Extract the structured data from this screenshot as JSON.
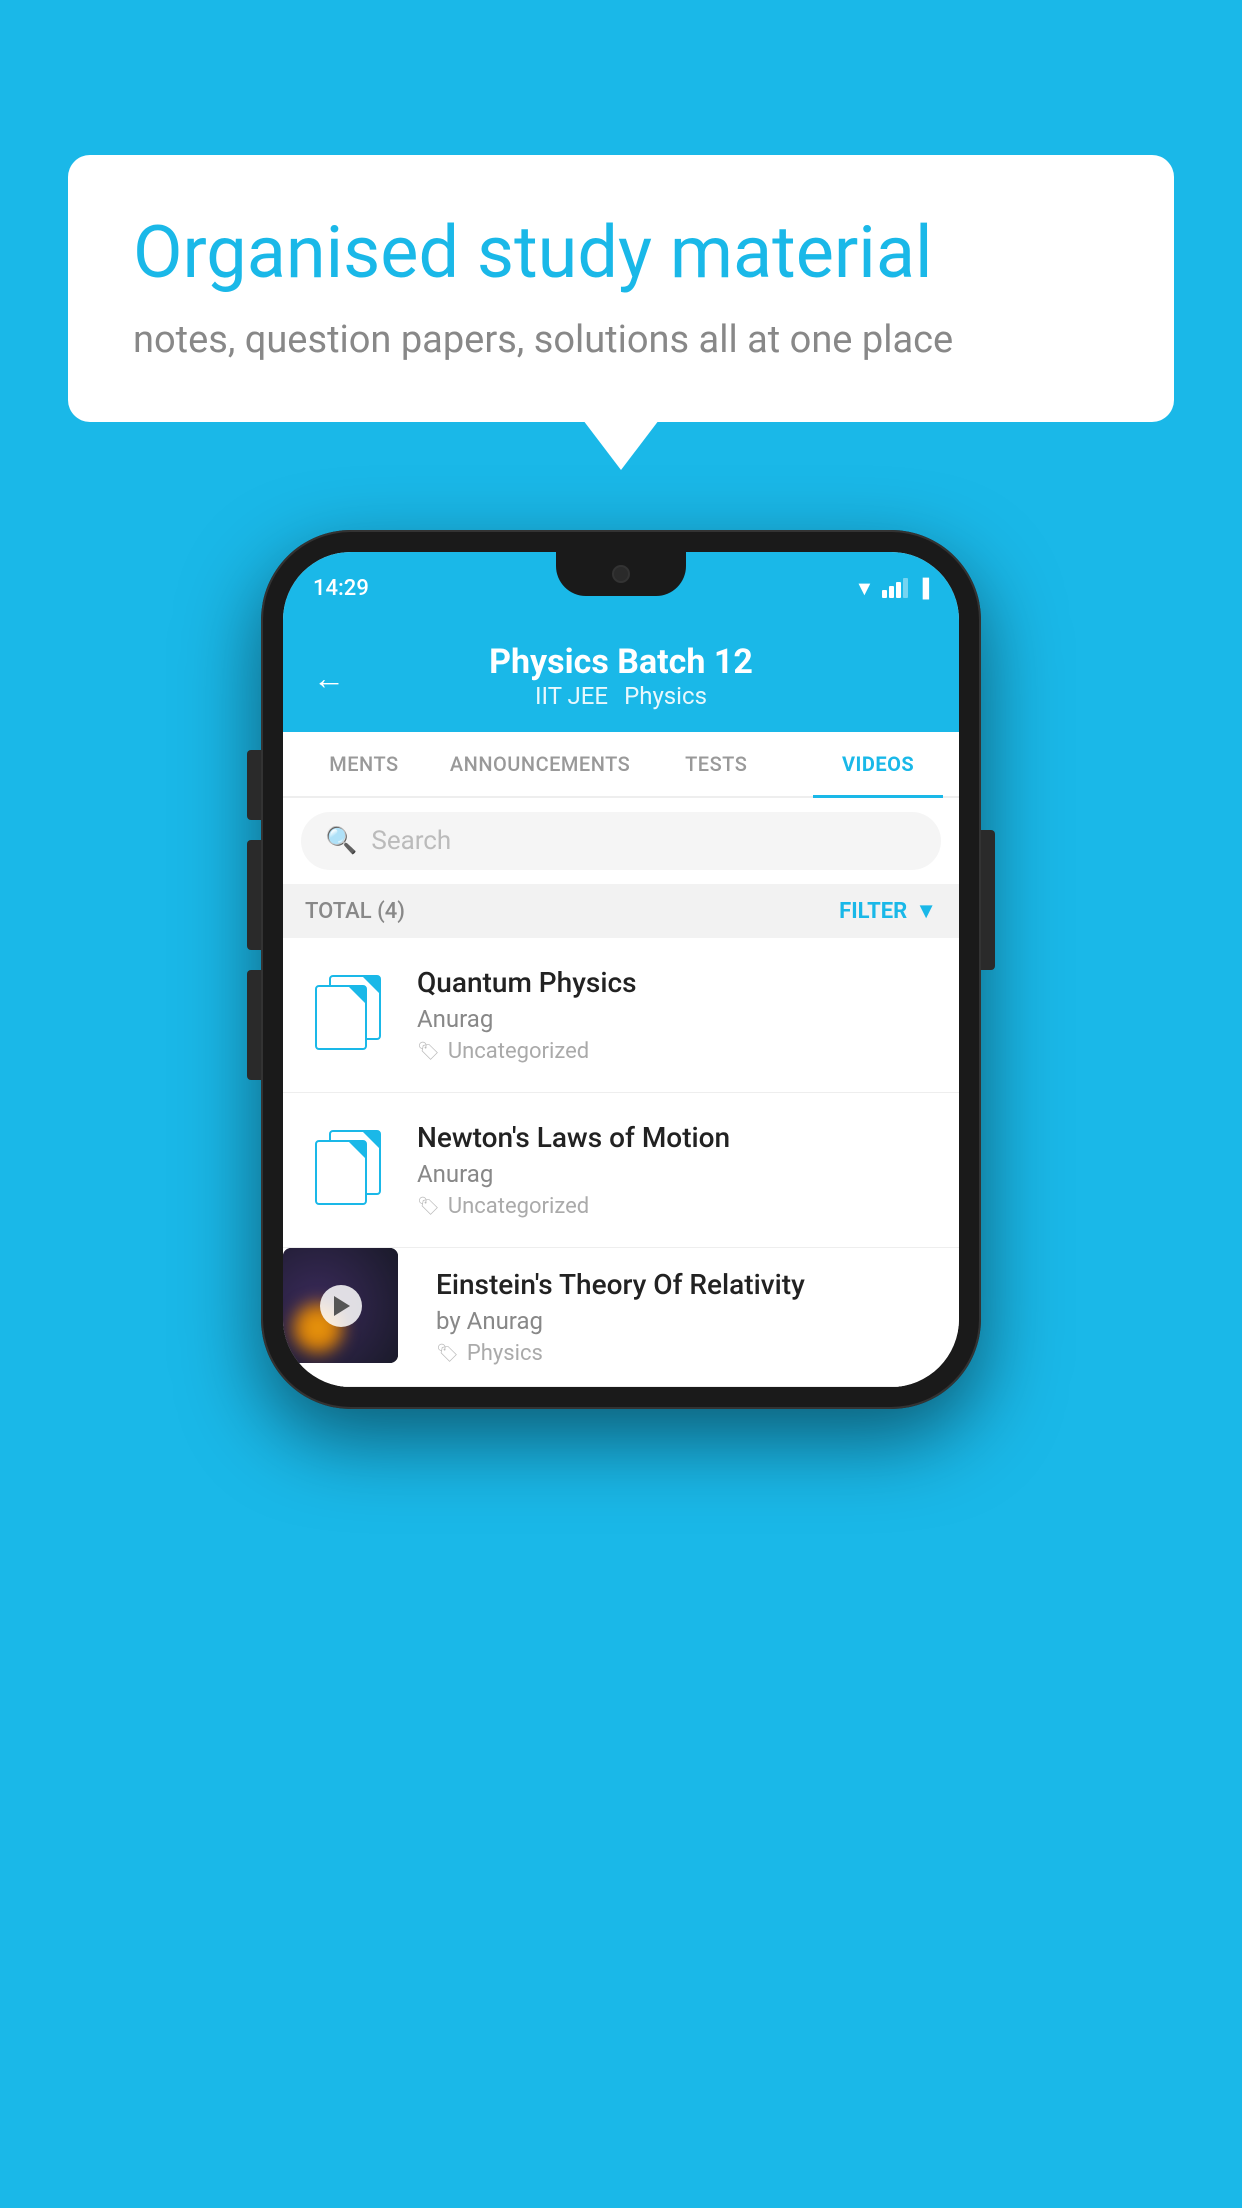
{
  "background_color": "#1AB8E8",
  "speech_bubble": {
    "title": "Organised study material",
    "subtitle": "notes, question papers, solutions all at one place"
  },
  "phone": {
    "status_bar": {
      "time": "14:29"
    },
    "header": {
      "back_label": "←",
      "title": "Physics Batch 12",
      "subtitle_left": "IIT JEE",
      "subtitle_right": "Physics"
    },
    "tabs": [
      {
        "label": "MENTS",
        "active": false
      },
      {
        "label": "ANNOUNCEMENTS",
        "active": false
      },
      {
        "label": "TESTS",
        "active": false
      },
      {
        "label": "VIDEOS",
        "active": true
      }
    ],
    "search": {
      "placeholder": "Search"
    },
    "filter_bar": {
      "total_label": "TOTAL (4)",
      "filter_label": "FILTER"
    },
    "videos": [
      {
        "id": 1,
        "title": "Quantum Physics",
        "author": "Anurag",
        "tag": "Uncategorized",
        "type": "file",
        "has_thumbnail": false
      },
      {
        "id": 2,
        "title": "Newton's Laws of Motion",
        "author": "Anurag",
        "tag": "Uncategorized",
        "type": "file",
        "has_thumbnail": false
      },
      {
        "id": 3,
        "title": "Einstein's Theory Of Relativity",
        "author": "by Anurag",
        "tag": "Physics",
        "type": "video",
        "has_thumbnail": true
      }
    ]
  }
}
